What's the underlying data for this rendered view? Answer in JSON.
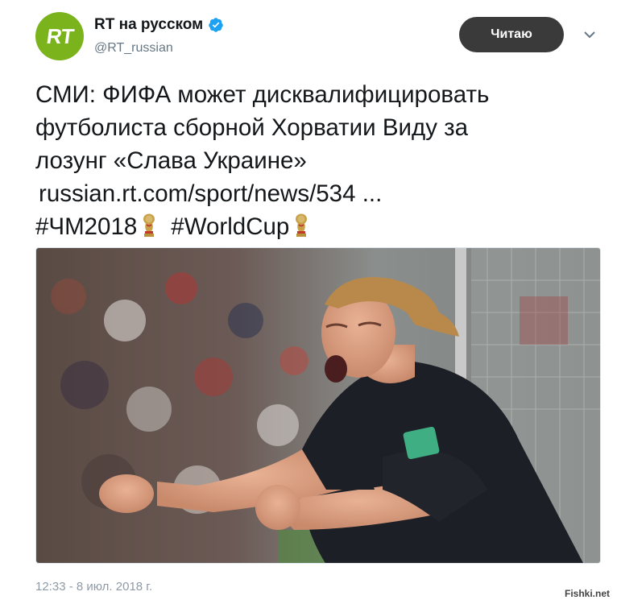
{
  "author": {
    "display_name": "RT на русском",
    "handle": "@RT_russian",
    "avatar_text": "RT",
    "avatar_color": "#7ab31c",
    "verified": true
  },
  "follow_button": {
    "label": "Читаю"
  },
  "tweet": {
    "lines": [
      "СМИ: ФИФА может дисквалифицировать",
      "футболиста сборной Хорватии Виду за",
      "лозунг «Слава Украине»"
    ],
    "link": "russian.rt.com/sport/news/534 ...",
    "hashtags": [
      "#ЧМ2018",
      "#WorldCup"
    ]
  },
  "timestamp": "12:33 - 8 июл. 2018 г.",
  "watermark": "Fishki.net",
  "colors": {
    "accent": "#1da1f2",
    "follow_bg": "#3a3a3a",
    "muted": "#657786"
  }
}
